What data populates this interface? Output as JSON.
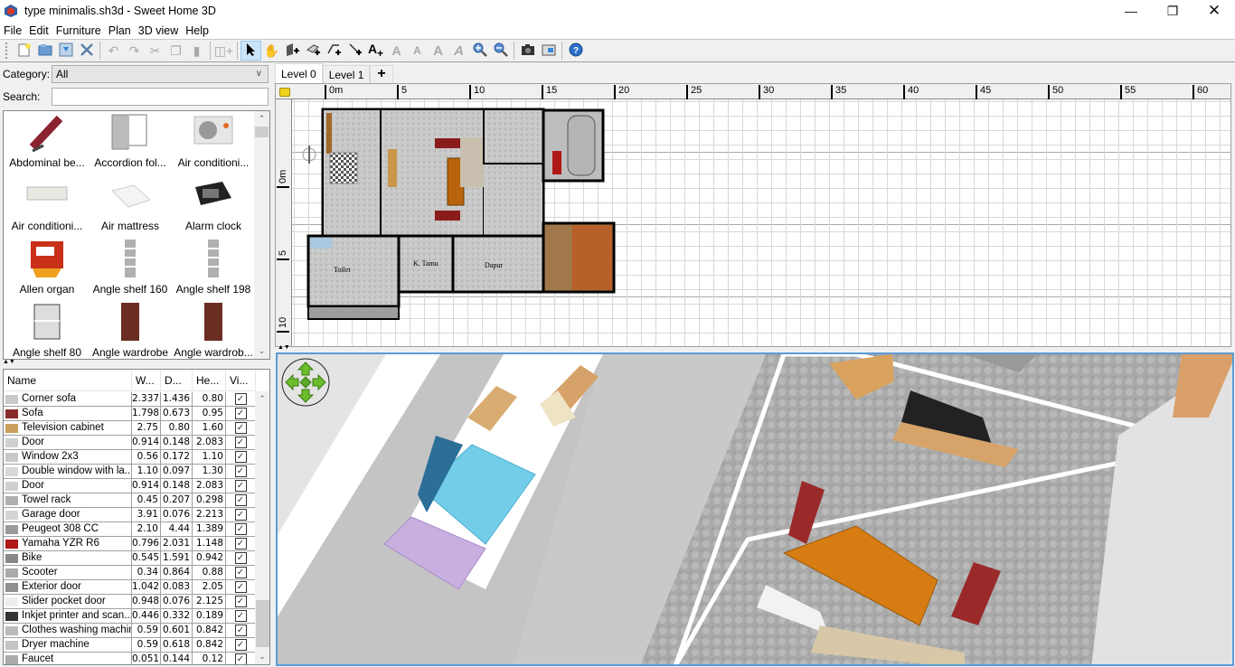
{
  "window": {
    "title": "type minimalis.sh3d - Sweet Home 3D",
    "controls": [
      "minimize",
      "restore",
      "close"
    ]
  },
  "menu": [
    {
      "label": "File",
      "mnemonic": "F",
      "rest": "ile"
    },
    {
      "label": "Edit",
      "mnemonic": "E",
      "rest": "dit"
    },
    {
      "label": "Furniture",
      "mnemonic": "",
      "pre": "F",
      "mn2": "u",
      "rest": "rniture"
    },
    {
      "label": "Plan",
      "mnemonic": "P",
      "rest": "lan"
    },
    {
      "label": "3D view",
      "pre": "3D ",
      "mn2": "v",
      "rest": "iew"
    },
    {
      "label": "Help",
      "mnemonic": "H",
      "rest": "elp"
    }
  ],
  "toolbar": {
    "buttons": [
      {
        "id": "new",
        "icon": "new-file-icon",
        "enabled": true
      },
      {
        "id": "open",
        "icon": "open-folder-icon",
        "enabled": true
      },
      {
        "id": "save",
        "icon": "save-icon",
        "enabled": true
      },
      {
        "id": "preferences",
        "icon": "tools-icon",
        "enabled": true
      },
      {
        "id": "undo",
        "icon": "undo-icon",
        "enabled": false
      },
      {
        "id": "redo",
        "icon": "redo-icon",
        "enabled": false
      },
      {
        "id": "cut",
        "icon": "cut-icon",
        "enabled": false
      },
      {
        "id": "copy",
        "icon": "copy-icon",
        "enabled": false
      },
      {
        "id": "paste",
        "icon": "paste-icon",
        "enabled": false
      },
      {
        "id": "add-furniture",
        "icon": "add-furniture-icon",
        "enabled": false
      },
      {
        "id": "select",
        "icon": "select-arrow-icon",
        "enabled": true,
        "selected": true
      },
      {
        "id": "pan",
        "icon": "pan-hand-icon",
        "enabled": true
      },
      {
        "id": "create-walls",
        "icon": "create-walls-icon",
        "enabled": true
      },
      {
        "id": "create-rooms",
        "icon": "create-rooms-icon",
        "enabled": true
      },
      {
        "id": "create-polylines",
        "icon": "create-polylines-icon",
        "enabled": true
      },
      {
        "id": "create-dimensions",
        "icon": "create-dimensions-icon",
        "enabled": true
      },
      {
        "id": "add-text",
        "icon": "add-text-icon",
        "enabled": true
      },
      {
        "id": "increase-text",
        "icon": "increase-text-size-icon",
        "enabled": false
      },
      {
        "id": "decrease-text",
        "icon": "decrease-text-size-icon",
        "enabled": false
      },
      {
        "id": "bold",
        "icon": "bold-text-icon",
        "enabled": false
      },
      {
        "id": "italic",
        "icon": "italic-text-icon",
        "enabled": false
      },
      {
        "id": "zoom-in",
        "icon": "zoom-in-icon",
        "enabled": true
      },
      {
        "id": "zoom-out",
        "icon": "zoom-out-icon",
        "enabled": true
      },
      {
        "id": "create-photo",
        "icon": "camera-icon",
        "enabled": true
      },
      {
        "id": "create-video",
        "icon": "video-icon",
        "enabled": true
      },
      {
        "id": "help",
        "icon": "help-icon",
        "enabled": true
      }
    ]
  },
  "catalog": {
    "category_label": "Category:",
    "category_value": "All",
    "search_label": "Search:",
    "search_value": "",
    "items": [
      {
        "name": "Abdominal be...",
        "icon": "abdominal-bench-icon"
      },
      {
        "name": "Accordion fol...",
        "icon": "accordion-door-icon"
      },
      {
        "name": "Air conditioni...",
        "icon": "air-conditioner-outdoor-icon"
      },
      {
        "name": "Air conditioni...",
        "icon": "air-conditioner-indoor-icon"
      },
      {
        "name": "Air mattress",
        "icon": "air-mattress-icon"
      },
      {
        "name": "Alarm clock",
        "icon": "alarm-clock-icon"
      },
      {
        "name": "Allen organ",
        "icon": "organ-icon"
      },
      {
        "name": "Angle shelf 160",
        "icon": "angle-shelf-icon"
      },
      {
        "name": "Angle shelf 198",
        "icon": "angle-shelf-icon"
      },
      {
        "name": "Angle shelf 80",
        "icon": "angle-shelf-low-icon"
      },
      {
        "name": "Angle wardrobe",
        "icon": "wardrobe-icon"
      },
      {
        "name": "Angle wardrob...",
        "icon": "wardrobe-icon"
      }
    ]
  },
  "furniture_table": {
    "columns": [
      "Name",
      "W...",
      "D...",
      "He...",
      "Vi..."
    ],
    "rows": [
      {
        "name": "Corner sofa",
        "w": "2.337",
        "d": "1.436",
        "h": "0.80",
        "visible": true,
        "icon": "sofa-icon",
        "color": "#c9c9c9"
      },
      {
        "name": "Sofa",
        "w": "1.798",
        "d": "0.673",
        "h": "0.95",
        "visible": true,
        "icon": "sofa-icon",
        "color": "#8b2c2c"
      },
      {
        "name": "Television cabinet",
        "w": "2.75",
        "d": "0.80",
        "h": "1.60",
        "visible": true,
        "icon": "cabinet-icon",
        "color": "#c9a05c"
      },
      {
        "name": "Door",
        "w": "0.914",
        "d": "0.148",
        "h": "2.083",
        "visible": true,
        "icon": "door-icon",
        "color": "#d0d0d0"
      },
      {
        "name": "Window 2x3",
        "w": "0.56",
        "d": "0.172",
        "h": "1.10",
        "visible": true,
        "icon": "window-icon",
        "color": "#c8c8c8"
      },
      {
        "name": "Double window with la...",
        "w": "1.10",
        "d": "0.097",
        "h": "1.30",
        "visible": true,
        "icon": "window-icon",
        "color": "#d8d8d8"
      },
      {
        "name": "Door",
        "w": "0.914",
        "d": "0.148",
        "h": "2.083",
        "visible": true,
        "icon": "door-icon",
        "color": "#d0d0d0"
      },
      {
        "name": "Towel rack",
        "w": "0.45",
        "d": "0.207",
        "h": "0.298",
        "visible": true,
        "icon": "towel-rack-icon",
        "color": "#b0b0b0"
      },
      {
        "name": "Garage door",
        "w": "3.91",
        "d": "0.076",
        "h": "2.213",
        "visible": true,
        "icon": "garage-door-icon",
        "color": "#d4d4d4"
      },
      {
        "name": "Peugeot 308 CC",
        "w": "2.10",
        "d": "4.44",
        "h": "1.389",
        "visible": true,
        "icon": "car-icon",
        "color": "#9a9a9a"
      },
      {
        "name": "Yamaha YZR R6",
        "w": "0.796",
        "d": "2.031",
        "h": "1.148",
        "visible": true,
        "icon": "motorbike-icon",
        "color": "#b01818"
      },
      {
        "name": "Bike",
        "w": "0.545",
        "d": "1.591",
        "h": "0.942",
        "visible": true,
        "icon": "bike-icon",
        "color": "#888888"
      },
      {
        "name": "Scooter",
        "w": "0.34",
        "d": "0.864",
        "h": "0.88",
        "visible": true,
        "icon": "scooter-icon",
        "color": "#aaaaaa"
      },
      {
        "name": "Exterior door",
        "w": "1.042",
        "d": "0.083",
        "h": "2.05",
        "visible": true,
        "icon": "door-icon",
        "color": "#909090"
      },
      {
        "name": "Slider pocket door",
        "w": "0.948",
        "d": "0.076",
        "h": "2.125",
        "visible": true,
        "icon": "door-icon",
        "color": "#eeeeee"
      },
      {
        "name": "Inkjet printer and scan...",
        "w": "0.446",
        "d": "0.332",
        "h": "0.189",
        "visible": true,
        "icon": "printer-icon",
        "color": "#333333"
      },
      {
        "name": "Clothes washing machine",
        "w": "0.59",
        "d": "0.601",
        "h": "0.842",
        "visible": true,
        "icon": "washing-machine-icon",
        "color": "#bbbbbb"
      },
      {
        "name": "Dryer machine",
        "w": "0.59",
        "d": "0.618",
        "h": "0.842",
        "visible": true,
        "icon": "dryer-icon",
        "color": "#c4c4c4"
      },
      {
        "name": "Faucet",
        "w": "0.051",
        "d": "0.144",
        "h": "0.12",
        "visible": true,
        "icon": "faucet-icon",
        "color": "#aaaaaa"
      }
    ]
  },
  "plan": {
    "levels": [
      {
        "label": "Level 0",
        "active": true
      },
      {
        "label": "Level 1",
        "active": false
      }
    ],
    "add_level_label": "+",
    "ruler_top": [
      "0m",
      "5",
      "10",
      "15",
      "20",
      "25",
      "30",
      "35",
      "40",
      "45",
      "50",
      "55",
      "60"
    ],
    "ruler_left": [
      "0m",
      "5",
      "10"
    ],
    "room_labels": [
      "Toilet",
      "K. Tamu",
      "Dapur"
    ]
  },
  "view3d": {
    "navigation": "navigation-arrows-icon"
  }
}
